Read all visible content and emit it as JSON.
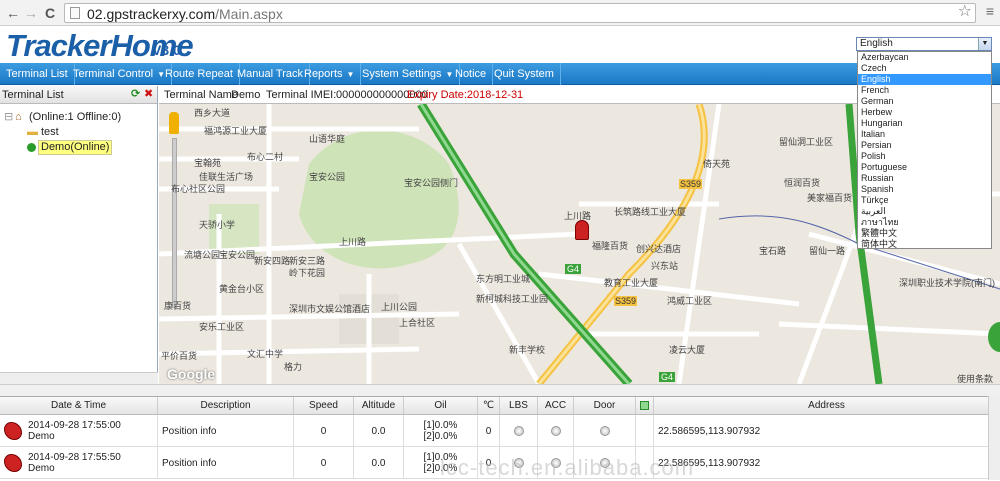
{
  "browser": {
    "back": "←",
    "forward": "→",
    "reload": "C",
    "url_host": "02.gpstrackerxy.com",
    "url_path": "/Main.aspx"
  },
  "app": {
    "logo": "TrackerHome",
    "version": "V3.0"
  },
  "nav": [
    {
      "label": "Terminal List"
    },
    {
      "label": "Terminal Control",
      "arrow": "▼"
    },
    {
      "label": "Route Repeat"
    },
    {
      "label": "Manual Track"
    },
    {
      "label": "Reports",
      "arrow": "▼"
    },
    {
      "label": "System Settings",
      "arrow": "▼"
    },
    {
      "label": "Notice"
    },
    {
      "label": "Quit System"
    }
  ],
  "sidebar": {
    "title": "Terminal List",
    "root": "(Online:1   Offline:0)",
    "group": "test",
    "device": "Demo(Online)"
  },
  "mapbar": {
    "name_label": "Terminal Name",
    "name": "Demo",
    "imei_label": "Terminal IMEI:",
    "imei": "000000000000000",
    "expiry": "Expiry Date:2018-12-31"
  },
  "language": {
    "selected": "English",
    "options": [
      "Azerbaycan",
      "Czech",
      "English",
      "French",
      "German",
      "Herbew",
      "Hungarian",
      "Italian",
      "Persian",
      "Polish",
      "Portuguese",
      "Russian",
      "Spanish",
      "Türkçe",
      "العربية",
      "ภาษาไทย",
      "繁體中文",
      "简体中文"
    ]
  },
  "map": {
    "labels": [
      "西乡大道",
      "福鸿源工业大厦",
      "山语华庭",
      "宝翰苑",
      "布心二村",
      "佳联生活广场",
      "布心社区公园",
      "宝安公园",
      "天骄小学",
      "流塘公园",
      "宝安公园",
      "宝安公园侧门",
      "上川路",
      "岭下花园",
      "黄金台小区",
      "新安四路",
      "新安三路",
      "深圳市文娱公馆酒店",
      "上川公园",
      "上合社区",
      "东方明工业城",
      "新柯城科技工业园",
      "福隆百货",
      "创兴达酒店",
      "兴东站",
      "教育工业大厦",
      "鸿威工业区",
      "凌云大厦",
      "新丰学校",
      "长筑路线工业大厦",
      "上川路",
      "倚天苑",
      "留仙洞工业区",
      "恒润百货",
      "美家福百货",
      "宝石路",
      "留仙一路",
      "深圳职业技术学院(南门)",
      "安乐工业区",
      "文汇中学",
      "格力",
      "平价百货",
      "康百货",
      "S359",
      "S359",
      "G4",
      "G4",
      "使用条款"
    ],
    "google": "Google"
  },
  "grid": {
    "headers": [
      "Date & Time",
      "Description",
      "Speed",
      "Altitude",
      "Oil",
      "℃",
      "LBS",
      "ACC",
      "Door",
      "",
      "Address"
    ],
    "rows": [
      {
        "time": "2014-09-28 17:55:00",
        "name": "Demo",
        "desc": "Position info",
        "speed": "0",
        "alt": "0.0",
        "oil1": "[1]0.0%",
        "oil2": "[2]0.0%",
        "temp": "0",
        "addr": "22.586595,113.907932"
      },
      {
        "time": "2014-09-28 17:55:50",
        "name": "Demo",
        "desc": "Position info",
        "speed": "0",
        "alt": "0.0",
        "oil1": "[1]0.0%",
        "oil2": "[2]0.0%",
        "temp": "0",
        "addr": "22.586595,113.907932"
      }
    ]
  },
  "watermark": "lcc-tech.en.alibaba.com",
  "colors": {
    "brand": "#1b5fa9",
    "nav": "#2a88d4",
    "expiry": "#cc0000",
    "online": "#2a9a2a"
  }
}
